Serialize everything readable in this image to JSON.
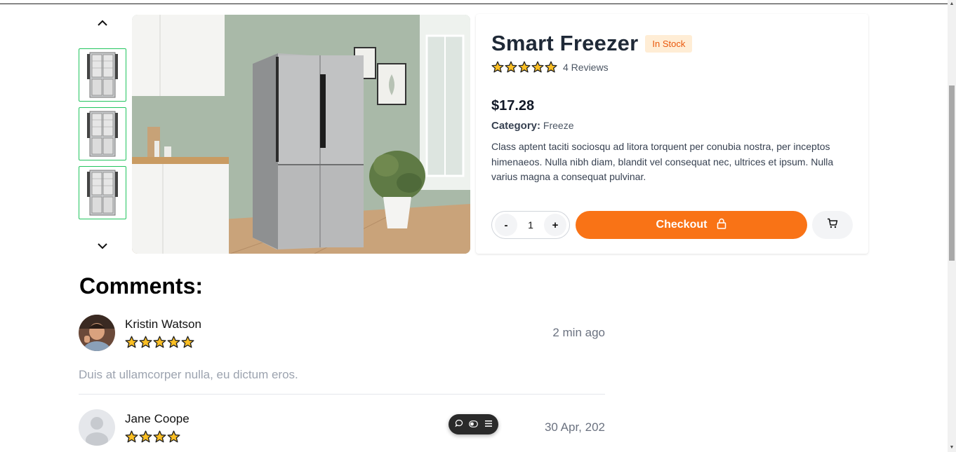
{
  "product": {
    "title": "Smart Freezer",
    "stock_badge": "In Stock",
    "rating": 5,
    "reviews_label": "4 Reviews",
    "price": "$17.28",
    "category_label": "Category:",
    "category_value": "Freeze",
    "description": "Class aptent taciti sociosqu ad litora torquent per conubia nostra, per inceptos himenaeos. Nulla nibh diam, blandit vel consequat nec, ultrices et ipsum. Nulla varius magna a consequat pulvinar."
  },
  "quantity": {
    "minus": "-",
    "value": "1",
    "plus": "+"
  },
  "checkout_label": "Checkout",
  "comments": {
    "title": "Comments:",
    "items": [
      {
        "name": "Kristin Watson",
        "stars": 5,
        "time": "2 min ago",
        "text": "Duis at ullamcorper nulla, eu dictum eros."
      },
      {
        "name": "Jane Coope",
        "stars": 4,
        "time": "30 Apr, 202",
        "text": ""
      }
    ]
  },
  "colors": {
    "accent": "#f97316",
    "badge_bg": "#ffedd5",
    "badge_text": "#ea580c",
    "thumb_border": "#22c55e",
    "star": "#fbbf24"
  },
  "icons": [
    "chevron-up-icon",
    "chevron-down-icon",
    "lock-icon",
    "cart-icon",
    "star-icon",
    "chat-icon",
    "toggle-icon",
    "menu-icon"
  ]
}
